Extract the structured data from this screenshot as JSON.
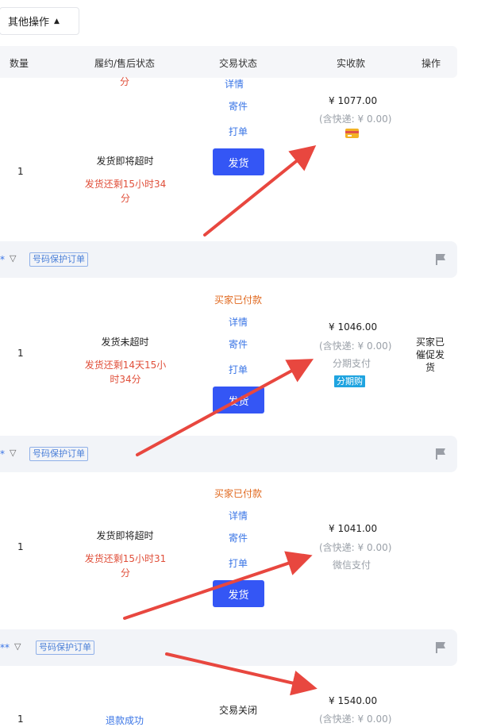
{
  "toolbar": {
    "other_ops_label": "其他操作"
  },
  "table_header": {
    "qty": "数量",
    "fulfillment": "履约/售后状态",
    "trade_status": "交易状态",
    "received": "实收款",
    "action": "操作"
  },
  "partial_top": {
    "status_tail": "分"
  },
  "orders": [
    {
      "qty": "1",
      "fulfillment_status": "发货即将超时",
      "remaining": "发货还剩15小时34分",
      "detail_label": "详情",
      "send_label": "寄件",
      "print_label": "打单",
      "ship_label": "发货",
      "amount": "¥ 1077.00",
      "shipping": "(含快递: ¥ 0.00)",
      "pay_icon": "credit-card-icon"
    },
    {
      "band": {
        "mask": "*",
        "tag": "号码保护订单"
      },
      "qty": "1",
      "trade_status": "买家已付款",
      "fulfillment_status": "发货未超时",
      "remaining": "发货还剩14天15小时34分",
      "detail_label": "详情",
      "send_label": "寄件",
      "print_label": "打单",
      "ship_label": "发货",
      "amount": "¥ 1046.00",
      "shipping": "(含快递: ¥ 0.00)",
      "pay_method": "分期支付",
      "installment_badge": "分期购",
      "action_note": "买家已催促发货"
    },
    {
      "band": {
        "mask": "*",
        "tag": "号码保护订单"
      },
      "qty": "1",
      "trade_status": "买家已付款",
      "fulfillment_status": "发货即将超时",
      "remaining": "发货还剩15小时31分",
      "detail_label": "详情",
      "send_label": "寄件",
      "print_label": "打单",
      "ship_label": "发货",
      "amount": "¥ 1041.00",
      "shipping": "(含快递: ¥ 0.00)",
      "pay_method": "微信支付"
    },
    {
      "band": {
        "mask": "**",
        "tag": "号码保护订单"
      },
      "qty": "1",
      "trade_status": "交易关闭",
      "refund_status": "退款成功",
      "amount": "¥ 1540.00",
      "shipping": "(含快递: ¥ 0.00)"
    }
  ],
  "colors": {
    "accent_blue": "#3456f5",
    "link_blue": "#3a75e6",
    "warning_red": "#e04f3a",
    "paid_orange": "#e0681e",
    "arrow_red": "#e8473f",
    "installment_badge": "#1fa4e0"
  }
}
